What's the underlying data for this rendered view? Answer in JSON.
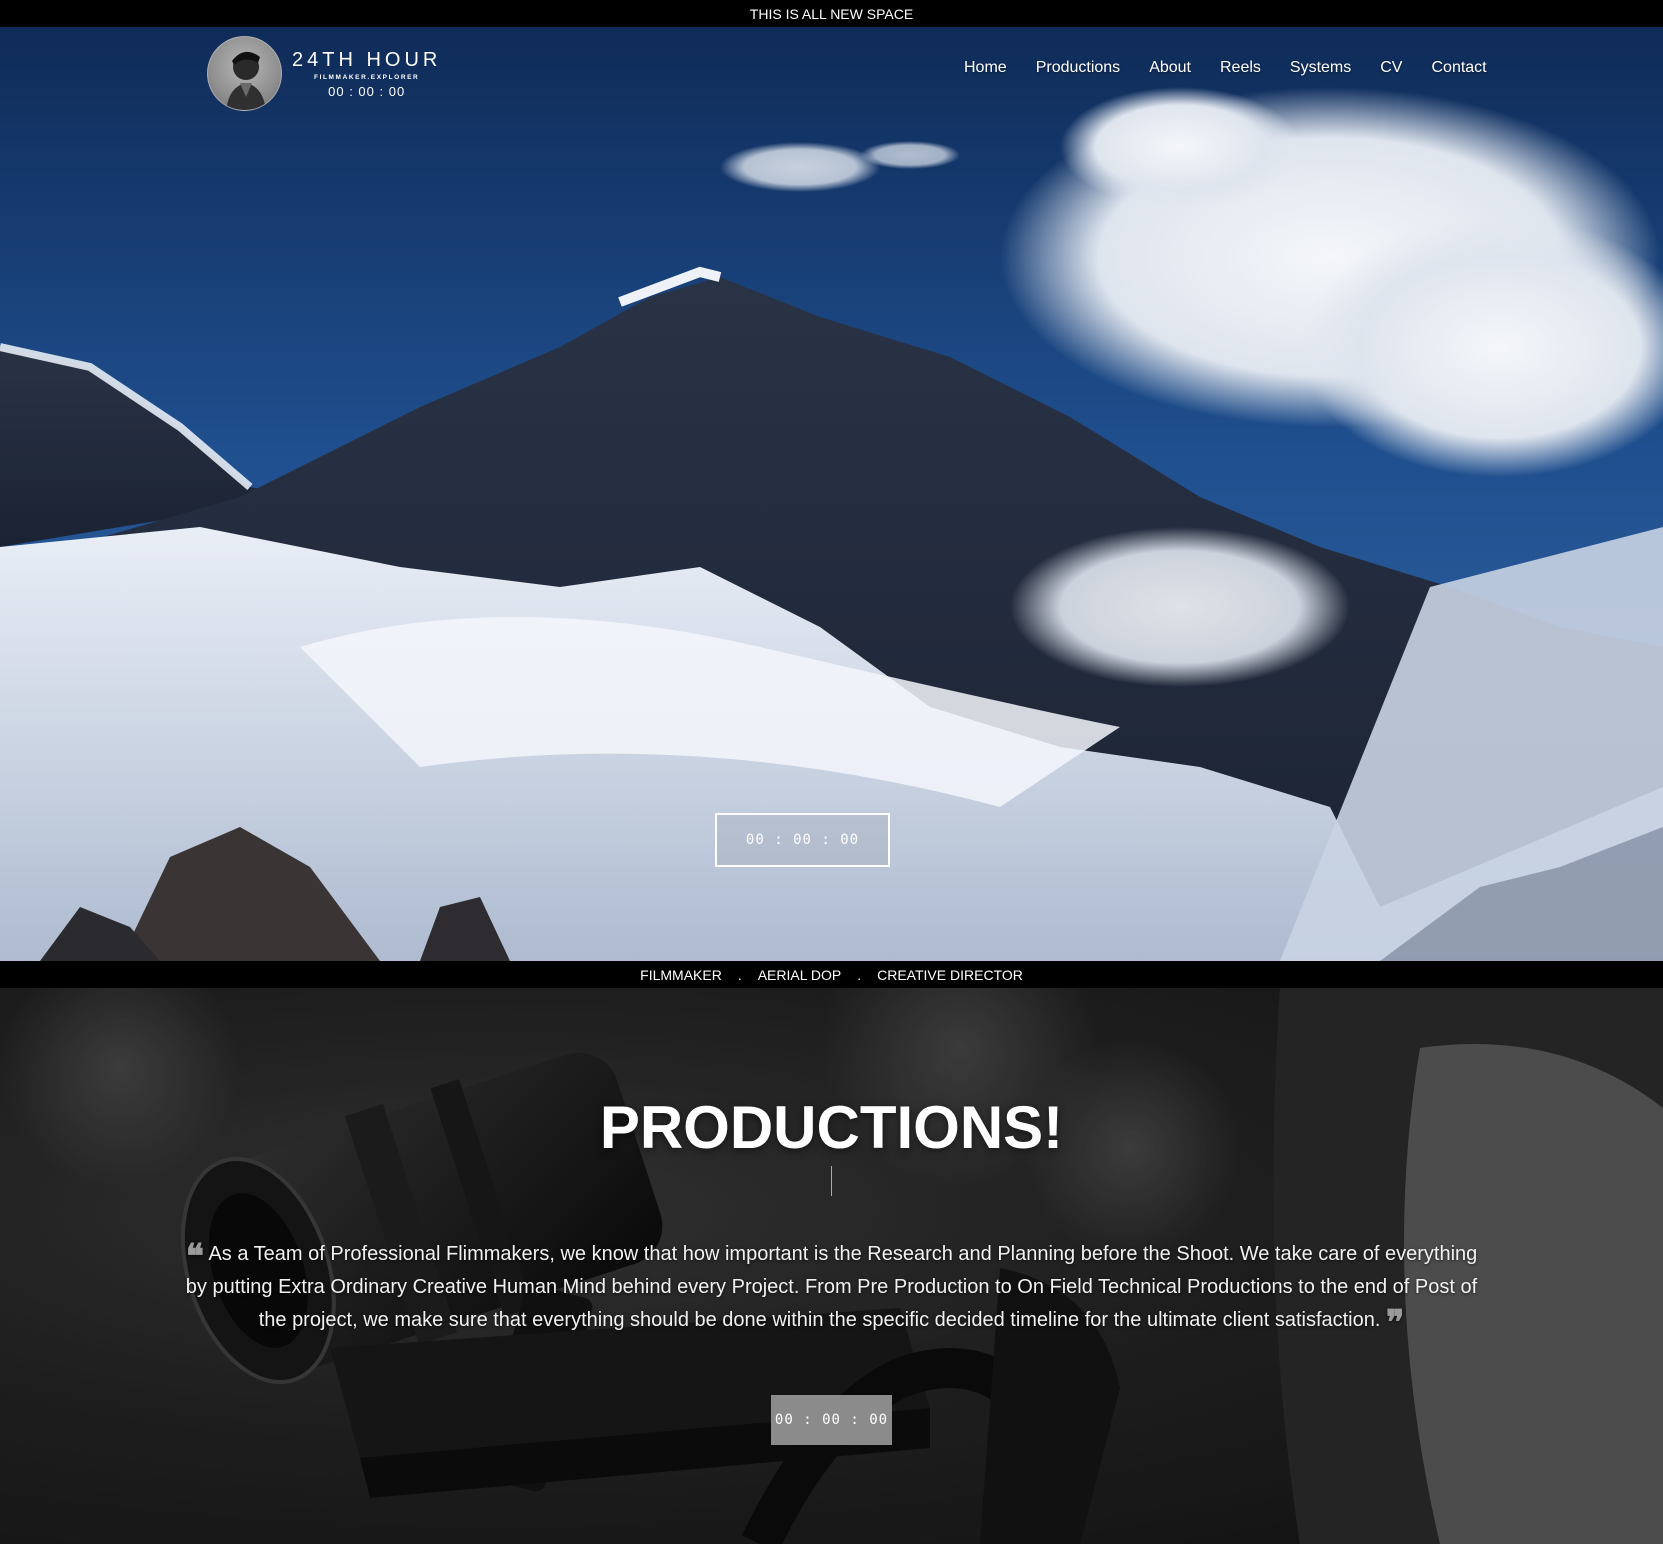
{
  "topbar": {
    "text": "THIS IS ALL NEW SPACE"
  },
  "brand": {
    "title": "24TH HOUR",
    "subtitle": "FILMMAKER.EXPLORER",
    "timer": "00 : 00 : 00",
    "avatar_icon": "portrait-avatar"
  },
  "nav": {
    "items": [
      {
        "label": "Home"
      },
      {
        "label": "Productions"
      },
      {
        "label": "About"
      },
      {
        "label": "Reels"
      },
      {
        "label": "Systems"
      },
      {
        "label": "CV"
      },
      {
        "label": "Contact"
      }
    ]
  },
  "hero": {
    "button_label": "00 : 00 : 00"
  },
  "roles": {
    "items": [
      "FILMMAKER",
      "AERIAL DOP",
      "CREATIVE DIRECTOR"
    ],
    "separator": "."
  },
  "productions": {
    "title": "PRODUCTIONS!",
    "quote": "As a Team of Professional Flimmakers, we know that how important is the Research and Planning before the Shoot. We take care of everything by putting Extra Ordinary Creative Human Mind behind every Project. From Pre Production to On Field Technical Productions to the end of Post of the project, we make sure that everything should be done within the specific decided timeline for the ultimate client satisfaction.",
    "open_quote": "❝",
    "close_quote": "❞",
    "button_label": "00 : 00 : 00"
  },
  "colors": {
    "bar_bg": "#000000",
    "sky": "#1d4a86",
    "button_gray": "#8b8b8b"
  }
}
